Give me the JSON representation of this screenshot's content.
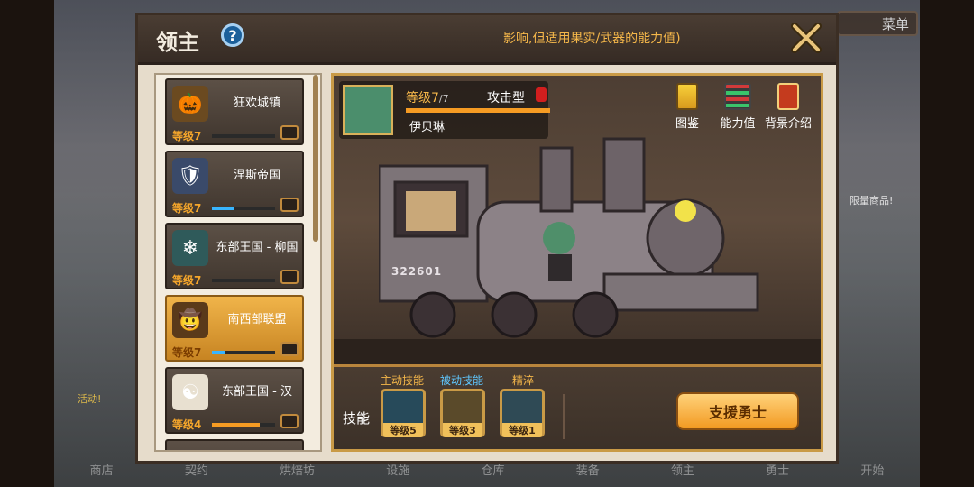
{
  "dialog": {
    "title": "领主",
    "help_symbol": "?",
    "notice": "影响,但适用果实/武器的能力值)"
  },
  "background": {
    "menu_label": "菜单",
    "limited_label": "限量商品!",
    "event_label": "活动!",
    "nav": [
      "商店",
      "契约",
      "烘焙坊",
      "设施",
      "仓库",
      "装备",
      "领主",
      "勇士",
      "开始"
    ]
  },
  "lords": [
    {
      "name": "狂欢城镇",
      "level": "等级7",
      "progress": 0.0,
      "bar_color": "blue",
      "emblem": "crown-pumpkin-icon"
    },
    {
      "name": "涅斯帝国",
      "level": "等级7",
      "progress": 0.35,
      "bar_color": "blue",
      "emblem": "eagle-shield-icon"
    },
    {
      "name": "东部王国 - 柳国",
      "level": "等级7",
      "progress": 0.0,
      "bar_color": "blue",
      "emblem": "snowflake-icon"
    },
    {
      "name": "南西部联盟",
      "level": "等级7",
      "progress": 0.2,
      "bar_color": "blue",
      "emblem": "cowboy-hat-icon",
      "selected": true
    },
    {
      "name": "东部王国 - 汉",
      "level": "等级4",
      "progress": 0.75,
      "bar_color": "orange",
      "emblem": "taegeuk-icon"
    }
  ],
  "hero": {
    "level_label": "等级7",
    "level_max": "/7",
    "type": "攻击型",
    "name": "伊贝琳",
    "progress": 1.0
  },
  "top_buttons": {
    "codex": "图鉴",
    "stats": "能力值",
    "story": "背景介绍"
  },
  "train": {
    "number": "322601"
  },
  "skills": {
    "label": "技能",
    "items": [
      {
        "title": "主动技能",
        "level": "等级5",
        "title_color": "gold"
      },
      {
        "title": "被动技能",
        "level": "等级3",
        "title_color": "blue"
      },
      {
        "title": "精淬",
        "level": "等级1",
        "title_color": "gold"
      }
    ],
    "support_button": "支援勇士"
  }
}
